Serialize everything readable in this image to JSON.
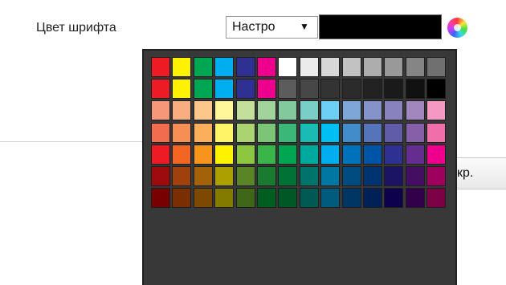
{
  "font_color": {
    "label": "Цвет шрифта",
    "select_value": "Настро",
    "select_arrow": "▼",
    "current_color": "#000000"
  },
  "partial_button": {
    "label": "кр."
  },
  "palette": {
    "grid": [
      [
        "#ed1c24",
        "#fff200",
        "#00a651",
        "#00adef",
        "#2e3192",
        "#ec008c",
        "#ffffff",
        "#ebebeb",
        "#d7d7d7",
        "#c2c2c2",
        "#adadad",
        "#999999",
        "#858585",
        "#707070"
      ],
      [
        "#ed1c24",
        "#fff200",
        "#00a651",
        "#00adef",
        "#2e3192",
        "#ec008c",
        "#5c5c5c",
        "#474747",
        "#333333",
        "#2b2b2b",
        "#222222",
        "#1a1a1a",
        "#111111",
        "#000000"
      ],
      [
        "#f7977a",
        "#f9ad81",
        "#fdc68a",
        "#fff79a",
        "#c4df9b",
        "#a3d39c",
        "#82ca9d",
        "#7bcdc8",
        "#6ecff6",
        "#7ea7d8",
        "#8493ca",
        "#8882be",
        "#a187be",
        "#f49ac2"
      ],
      [
        "#f26c4f",
        "#f68e55",
        "#fbaf5c",
        "#fff467",
        "#acd372",
        "#7cc576",
        "#3bb878",
        "#1abbb4",
        "#00bff3",
        "#438cca",
        "#5574b9",
        "#605ca8",
        "#855fa8",
        "#f06ea9"
      ],
      [
        "#ed1c24",
        "#f26522",
        "#f7941d",
        "#fff200",
        "#8dc73f",
        "#39b54a",
        "#00a651",
        "#00a99d",
        "#00aeef",
        "#0072bc",
        "#0054a5",
        "#2e3192",
        "#662d91",
        "#ec008c"
      ],
      [
        "#9e0b0f",
        "#a0410d",
        "#a36209",
        "#aba000",
        "#598527",
        "#1a7b30",
        "#007236",
        "#00746b",
        "#0076a3",
        "#004b80",
        "#003471",
        "#1b1464",
        "#440e62",
        "#9e005d"
      ],
      [
        "#790000",
        "#7b2e00",
        "#7d4900",
        "#827b00",
        "#406618",
        "#005e20",
        "#005826",
        "#005952",
        "#005b7f",
        "#003663",
        "#002157",
        "#0d004c",
        "#32004b",
        "#7b0046"
      ]
    ]
  }
}
